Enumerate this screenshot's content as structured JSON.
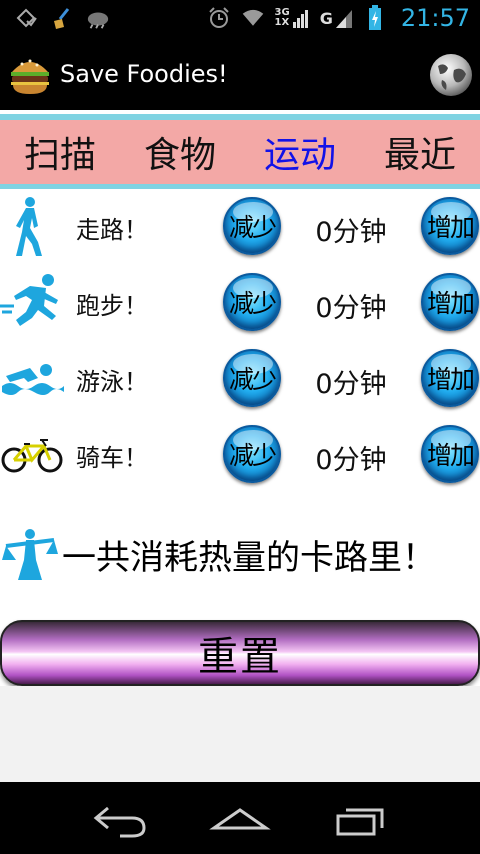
{
  "status_bar": {
    "left_icons": [
      "notification-icon",
      "broom-icon",
      "weather-icon"
    ],
    "right_icons": [
      "alarm-icon",
      "wifi-icon",
      "signal-3g-icon",
      "signal-g-icon",
      "battery-charging-icon"
    ],
    "network_top": "3G",
    "network_bottom": "1X",
    "network_g": "G",
    "time": "21:57"
  },
  "action_bar": {
    "app_icon": "burger-icon",
    "title": "Save Foodies!",
    "right_icon": "globe-icon"
  },
  "tabs": [
    {
      "label": "扫描",
      "active": false
    },
    {
      "label": "食物",
      "active": false
    },
    {
      "label": "运动",
      "active": true
    },
    {
      "label": "最近",
      "active": false
    }
  ],
  "activities": [
    {
      "icon": "walking-icon",
      "label": "走路！",
      "decrease": "减少",
      "minutes": "0分钟",
      "increase": "增加"
    },
    {
      "icon": "running-icon",
      "label": "跑步！",
      "decrease": "减少",
      "minutes": "0分钟",
      "increase": "增加"
    },
    {
      "icon": "swimming-icon",
      "label": "游泳！",
      "decrease": "减少",
      "minutes": "0分钟",
      "increase": "增加"
    },
    {
      "icon": "bicycle-icon",
      "label": "骑车！",
      "decrease": "减少",
      "minutes": "0分钟",
      "increase": "增加"
    }
  ],
  "total": {
    "icon": "scale-icon",
    "text": "一共消耗热量的卡路里！"
  },
  "reset_button": "重置",
  "nav": [
    "back-icon",
    "home-icon",
    "recent-apps-icon"
  ],
  "colors": {
    "accent": "#33b5e5",
    "tab_background": "#f3a8a6",
    "tab_active": "#1212e8",
    "divider": "#7fd3e2",
    "icon_blue": "#1ea6de"
  }
}
